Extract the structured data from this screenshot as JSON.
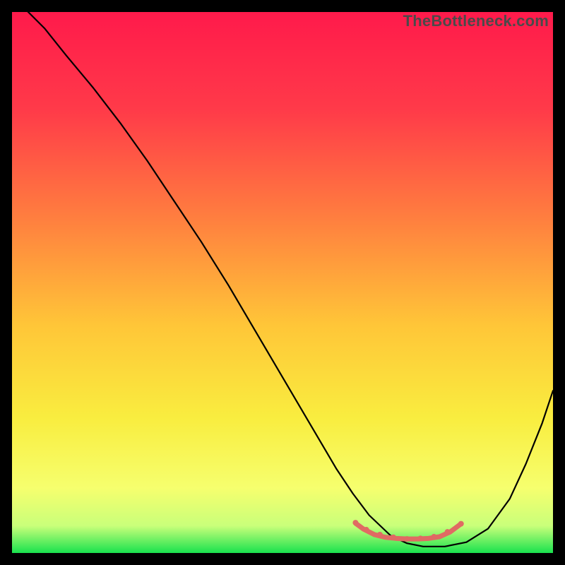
{
  "watermark": "TheBottleneck.com",
  "chart_data": {
    "type": "line",
    "title": "",
    "xlabel": "",
    "ylabel": "",
    "xlim": [
      0,
      100
    ],
    "ylim": [
      0,
      100
    ],
    "grid": false,
    "legend": false,
    "gradient_stops": [
      {
        "offset": 0.0,
        "color": "#ff1a4b"
      },
      {
        "offset": 0.18,
        "color": "#ff3a49"
      },
      {
        "offset": 0.38,
        "color": "#ff7e3f"
      },
      {
        "offset": 0.58,
        "color": "#ffc638"
      },
      {
        "offset": 0.75,
        "color": "#f9ed3f"
      },
      {
        "offset": 0.88,
        "color": "#f6ff6e"
      },
      {
        "offset": 0.95,
        "color": "#c9ff7a"
      },
      {
        "offset": 1.0,
        "color": "#19e24e"
      }
    ],
    "series": [
      {
        "name": "main-curve",
        "color": "#000000",
        "x": [
          2,
          6,
          10,
          15,
          20,
          25,
          30,
          35,
          40,
          45,
          50,
          55,
          60,
          63,
          66,
          70,
          73,
          76,
          80,
          84,
          88,
          92,
          95,
          98,
          100
        ],
        "y": [
          101,
          97,
          92,
          86,
          79.5,
          72.5,
          65,
          57.5,
          49.5,
          41,
          32.5,
          24,
          15.5,
          11,
          7,
          3.2,
          1.8,
          1.2,
          1.2,
          2.0,
          4.5,
          10,
          16.5,
          24,
          30
        ]
      },
      {
        "name": "bottom-highlight",
        "color": "#e06a63",
        "x": [
          63.5,
          65,
          67,
          69,
          71,
          73,
          75,
          77,
          79,
          81,
          83
        ],
        "y": [
          5.5,
          4.4,
          3.4,
          2.9,
          2.7,
          2.6,
          2.6,
          2.7,
          3.0,
          3.9,
          5.4
        ]
      }
    ],
    "dots": {
      "name": "bottom-dots",
      "color": "#e06a63",
      "x": [
        63.5,
        65.5,
        68,
        70.5,
        73,
        75.5,
        78,
        80.5,
        83
      ],
      "y": [
        5.6,
        4.3,
        3.4,
        2.9,
        2.6,
        2.7,
        3.0,
        3.9,
        5.4
      ],
      "r": 4.0
    }
  }
}
